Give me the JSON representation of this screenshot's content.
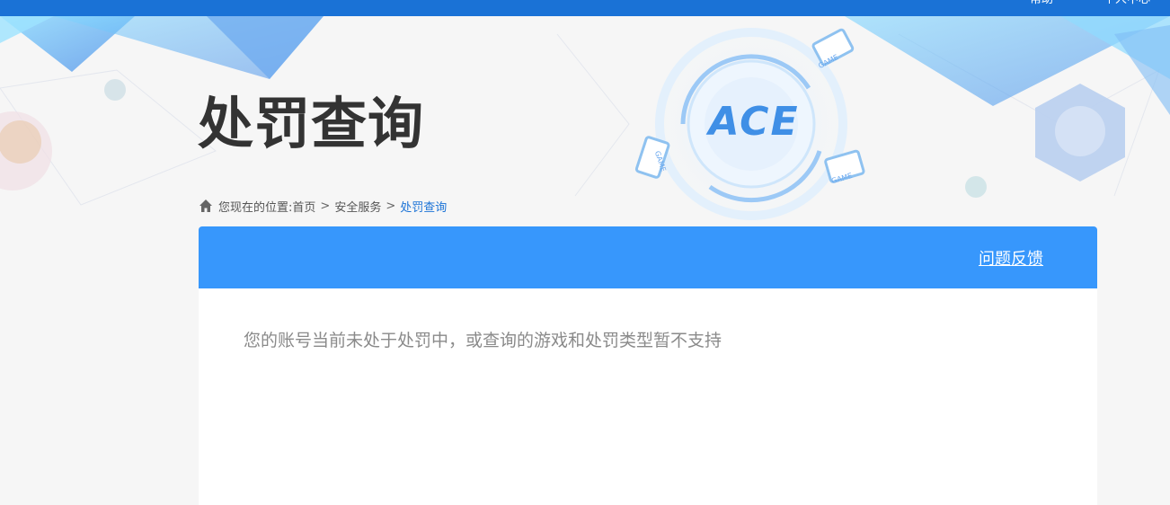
{
  "topbar": {
    "cut_text_1": "帮助",
    "cut_text_2": "个人中心"
  },
  "banner": {
    "logo_text": "ACE",
    "game_tag": "GAME"
  },
  "page": {
    "title": "处罚查询"
  },
  "breadcrumb": {
    "prefix": "您现在的位置:",
    "items": [
      "首页",
      "安全服务",
      "处罚查询"
    ],
    "separator": ">"
  },
  "panel": {
    "feedback_label": "问题反馈",
    "message": "您的账号当前未处于处罚中，或查询的游戏和处罚类型暂不支持"
  },
  "colors": {
    "topbar": "#1a72d6",
    "panel_header": "#3797fc",
    "accent_link": "#1a72d6"
  }
}
